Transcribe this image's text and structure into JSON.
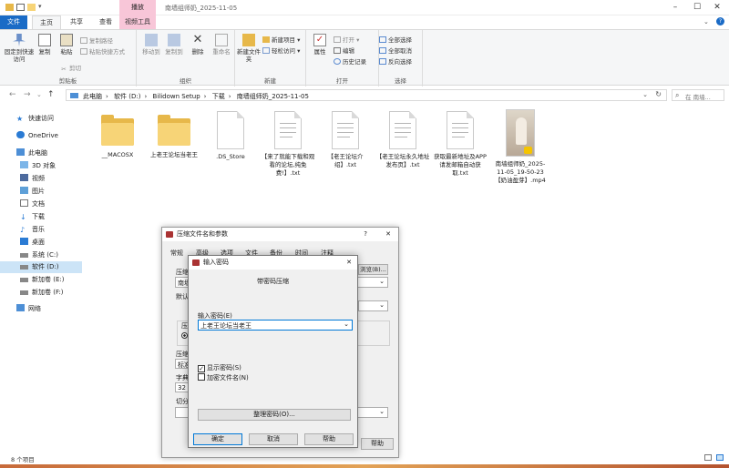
{
  "window": {
    "title": "南墙组师奶_2025-11-05"
  },
  "tabs": {
    "file": "文件",
    "home": "主页",
    "share": "共享",
    "view": "查看",
    "contextual_group": "播放",
    "video_tools": "视频工具"
  },
  "ribbon": {
    "clipboard": {
      "pin": "固定到快速访问",
      "copy": "复制",
      "paste": "粘贴",
      "copy_path": "复制路径",
      "paste_shortcut": "粘贴快捷方式",
      "cut": "剪切",
      "label": "剪贴板"
    },
    "organize": {
      "move_to": "移动到",
      "copy_to": "复制到",
      "delete": "删除",
      "rename": "重命名",
      "label": "组织"
    },
    "new": {
      "new_folder": "新建文件夹",
      "new_item": "新建项目",
      "easy_access": "轻松访问",
      "label": "新建"
    },
    "open": {
      "properties": "属性",
      "open": "打开",
      "edit": "编辑",
      "history": "历史记录",
      "label": "打开"
    },
    "select": {
      "select_all": "全部选择",
      "select_none": "全部取消",
      "invert": "反向选择",
      "label": "选择"
    }
  },
  "breadcrumb": [
    "此电脑",
    "软件 (D:)",
    "Bilidown Setup",
    "下载",
    "南墙组师奶_2025-11-05"
  ],
  "search": {
    "placeholder": "在 南墙..."
  },
  "sidebar": [
    {
      "label": "快速访问",
      "icon": "star-icon"
    },
    {
      "label": "OneDrive",
      "icon": "cloud-icon"
    },
    {
      "label": "此电脑",
      "icon": "computer-icon"
    },
    {
      "label": "3D 对象",
      "icon": "cube-icon"
    },
    {
      "label": "视频",
      "icon": "video-icon"
    },
    {
      "label": "图片",
      "icon": "picture-icon"
    },
    {
      "label": "文档",
      "icon": "document-icon"
    },
    {
      "label": "下载",
      "icon": "download-icon"
    },
    {
      "label": "音乐",
      "icon": "music-icon"
    },
    {
      "label": "桌面",
      "icon": "desktop-icon"
    },
    {
      "label": "系统 (C:)",
      "icon": "drive-icon"
    },
    {
      "label": "软件 (D:)",
      "icon": "drive-icon"
    },
    {
      "label": "新加卷 (E:)",
      "icon": "drive-icon"
    },
    {
      "label": "新加卷 (F:)",
      "icon": "drive-icon"
    },
    {
      "label": "网络",
      "icon": "network-icon"
    }
  ],
  "files": [
    {
      "name": "__MACOSX",
      "type": "folder"
    },
    {
      "name": "上老王论坛当老王",
      "type": "folder"
    },
    {
      "name": ".DS_Store",
      "type": "file"
    },
    {
      "name": "【来了就能下载和观看的论坛,纯免费!】.txt",
      "type": "doc"
    },
    {
      "name": "【老王论坛介绍】.txt",
      "type": "doc"
    },
    {
      "name": "【老王论坛永久地址发布页】.txt",
      "type": "doc"
    },
    {
      "name": "获取最新地址及APP请发邮箱自动获取.txt",
      "type": "doc"
    },
    {
      "name": "南墙组师奶_2025-11-05_19-50-23【奶油盈芽】.mp4",
      "type": "video"
    }
  ],
  "status": {
    "count": "8 个项目"
  },
  "archive_dialog": {
    "title": "压缩文件名和参数",
    "help_glyph": "?",
    "tabs": [
      "常规",
      "高级",
      "选项",
      "文件",
      "备份",
      "时间",
      "注释"
    ],
    "fragments": [
      "压缩",
      "南墙",
      "默认",
      "压缩",
      "压缩",
      "标准",
      "字典",
      "32 M",
      "切分",
      "浏览(B)..."
    ],
    "help_button": "帮助"
  },
  "password_dialog": {
    "title": "输入密码",
    "heading": "带密码压缩",
    "input_label": "输入密码(E)",
    "password_value": "上老王论坛当老王",
    "show_password": "显示密码(S)",
    "show_password_checked": true,
    "encrypt_names": "加密文件名(N)",
    "encrypt_names_checked": false,
    "organize_button": "整理密码(O)...",
    "ok": "确定",
    "cancel": "取消",
    "help": "帮助"
  }
}
